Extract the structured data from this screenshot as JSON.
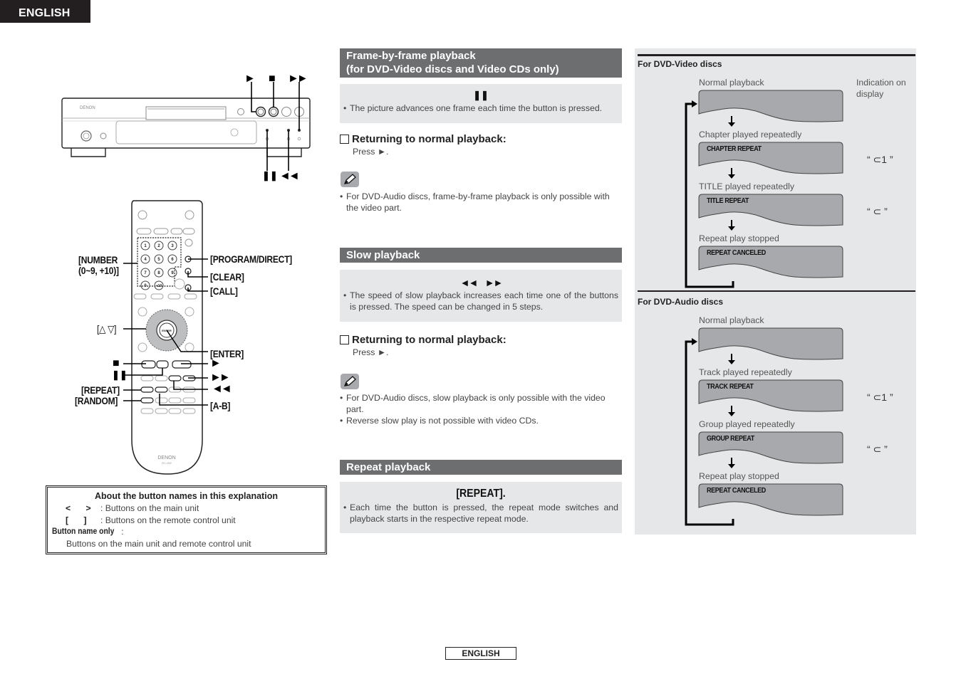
{
  "language_tab": "ENGLISH",
  "footer_language": "ENGLISH",
  "main_unit": {
    "brand": "DENON",
    "callouts_top": [
      {
        "symbol": "►",
        "name": "play"
      },
      {
        "symbol": "■",
        "name": "stop"
      },
      {
        "symbol": "►►",
        "name": "fast-forward"
      }
    ],
    "callouts_bottom": [
      {
        "symbol": "❚❚",
        "name": "pause"
      },
      {
        "symbol": "◄◄",
        "name": "rewind"
      }
    ]
  },
  "remote": {
    "brand": "DENON",
    "model": "RC-992",
    "callouts_left": {
      "number": "[NUMBER",
      "number_range": "(0~9, +10)]",
      "cursor": "[△ ▽]",
      "stop": "■",
      "pause": "❚❚",
      "repeat": "[REPEAT]",
      "random": "[RANDOM]"
    },
    "callouts_right": {
      "program_direct_prefix": "[PROGRAM",
      "program_direct_suffix": "/DIRECT]",
      "clear": "[CLEAR]",
      "call": "[CALL]",
      "enter": "[ENTER]",
      "play": "►",
      "fast_forward": "►►",
      "rewind": "◄◄",
      "a_b": "[A-B]"
    },
    "keypad": [
      "1",
      "2",
      "3",
      "4",
      "5",
      "6",
      "7",
      "8",
      "9",
      "0",
      "+10"
    ]
  },
  "info_box": {
    "title": "About the button names in this explanation",
    "rows": [
      {
        "keys": "< >",
        "desc": ": Buttons on the main unit"
      },
      {
        "keys": "[ ]",
        "desc": ": Buttons on the remote control unit"
      }
    ],
    "button_name_only_label": "Button name only",
    "button_name_only_colon": " :",
    "button_name_only_desc": "Buttons on the main unit and remote control unit"
  },
  "sections": {
    "frame_by_frame": {
      "title_line1": "Frame-by-frame playback",
      "title_line2": "(for DVD-Video discs and Video CDs only)",
      "button_symbol": "❚❚",
      "bullet": "The picture advances one frame each time the button is pressed.",
      "return_heading": "Returning to normal playback:",
      "press_text": "Press ►.",
      "note": "For DVD-Audio discs, frame-by-frame playback is only possible with the video part."
    },
    "slow": {
      "title": "Slow playback",
      "button_symbols": "◄◄      ►►",
      "bullet": "The speed of slow playback increases each time one of the buttons is pressed. The speed can be changed in 5 steps.",
      "return_heading": "Returning to normal playback:",
      "press_text": "Press ►.",
      "notes": [
        "For DVD-Audio discs, slow playback is only possible with the video part.",
        "Reverse slow play is not possible with video CDs."
      ]
    },
    "repeat": {
      "title": "Repeat playback",
      "button_label": "[REPEAT].",
      "bullet": "Each time the button is pressed, the repeat mode switches and playback starts in the respective repeat mode."
    }
  },
  "right_panel": {
    "indication_header": "Indication on display",
    "dvd_video": {
      "title": "For DVD-Video discs",
      "steps": [
        {
          "label": "Normal playback",
          "lcd": "",
          "indicator": ""
        },
        {
          "label": "Chapter played repeatedly",
          "lcd": "CHAPTER REPEAT",
          "indicator": "“ ⊂1 ”"
        },
        {
          "label": "TITLE played repeatedly",
          "lcd": "TITLE REPEAT",
          "indicator": "“ ⊂ ”"
        },
        {
          "label": "Repeat play stopped",
          "lcd": "REPEAT CANCELED",
          "indicator": ""
        }
      ]
    },
    "dvd_audio": {
      "title": "For DVD-Audio discs",
      "steps": [
        {
          "label": "Normal playback",
          "lcd": "",
          "indicator": ""
        },
        {
          "label": "Track played repeatedly",
          "lcd": "TRACK REPEAT",
          "indicator": "“ ⊂1 ”"
        },
        {
          "label": "Group played repeatedly",
          "lcd": "GROUP REPEAT",
          "indicator": "“ ⊂ ”"
        },
        {
          "label": "Repeat play stopped",
          "lcd": "REPEAT CANCELED",
          "indicator": ""
        }
      ]
    }
  }
}
